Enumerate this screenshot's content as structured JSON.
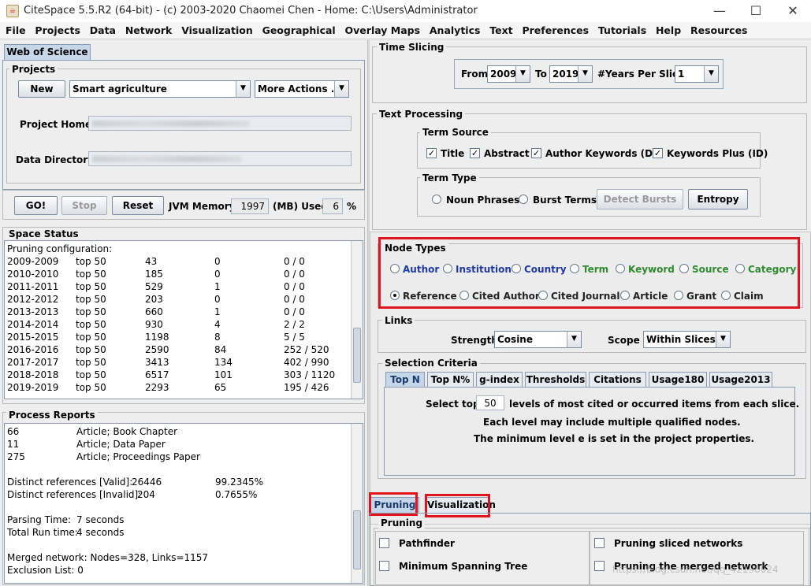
{
  "window": {
    "title": "CiteSpace 5.5.R2 (64-bit) - (c) 2003-2020 Chaomei Chen - Home: C:\\Users\\Administrator",
    "minimize": "—",
    "maximize": "☐",
    "close": "✕"
  },
  "menu": [
    "File",
    "Projects",
    "Data",
    "Network",
    "Visualization",
    "Geographical",
    "Overlay Maps",
    "Analytics",
    "Text",
    "Preferences",
    "Tutorials",
    "Help",
    "Resources"
  ],
  "left": {
    "source_tab": "Web of Science",
    "projects": {
      "legend": "Projects",
      "new_button": "New",
      "project_name": "Smart agriculture",
      "more_actions": "More Actions ...",
      "project_home_label": "Project Home:",
      "data_directory_label": "Data Directory:"
    },
    "controls": {
      "go": "GO!",
      "stop": "Stop",
      "reset": "Reset",
      "jvm_label": "JVM Memory",
      "jvm_value": "1997",
      "mb_used_label": "(MB) Used",
      "used_value": "6",
      "percent": "%"
    },
    "space_status": {
      "legend": "Space Status",
      "header": "Pruning configuration:",
      "rows": [
        [
          "2009-2009",
          "top 50",
          "43",
          "0",
          "0 / 0"
        ],
        [
          "2010-2010",
          "top 50",
          "185",
          "0",
          "0 / 0"
        ],
        [
          "2011-2011",
          "top 50",
          "529",
          "1",
          "0 / 0"
        ],
        [
          "2012-2012",
          "top 50",
          "203",
          "0",
          "0 / 0"
        ],
        [
          "2013-2013",
          "top 50",
          "660",
          "1",
          "0 / 0"
        ],
        [
          "2014-2014",
          "top 50",
          "930",
          "4",
          "2 / 2"
        ],
        [
          "2015-2015",
          "top 50",
          "1198",
          "8",
          "5 / 5"
        ],
        [
          "2016-2016",
          "top 50",
          "2590",
          "84",
          "252 / 520"
        ],
        [
          "2017-2017",
          "top 50",
          "3413",
          "134",
          "402 / 990"
        ],
        [
          "2018-2018",
          "top 50",
          "6517",
          "101",
          "303 / 1120"
        ],
        [
          "2019-2019",
          "top 50",
          "2293",
          "65",
          "195 / 426"
        ]
      ]
    },
    "process_reports": {
      "legend": "Process Reports",
      "doc_rows": [
        [
          "66",
          "Article; Book Chapter"
        ],
        [
          "11",
          "Article; Data Paper"
        ],
        [
          "275",
          "Article; Proceedings Paper"
        ]
      ],
      "valid_label": "Distinct references [Valid]:",
      "valid_count": "26446",
      "valid_pct": "99.2345%",
      "invalid_label": "Distinct references [Invalid]:",
      "invalid_count": "204",
      "invalid_pct": "0.7655%",
      "parsing_label": "Parsing Time:",
      "parsing_value": "7 seconds",
      "total_label": "Total Run time:",
      "total_value": "4 seconds",
      "merged": "Merged network: Nodes=328, Links=1157",
      "exclusion": "Exclusion List: 0"
    }
  },
  "right": {
    "time_slicing": {
      "legend": "Time Slicing",
      "from_label": "From",
      "from_value": "2009",
      "to_label": "To",
      "to_value": "2019",
      "years_label": "#Years Per Slice",
      "years_value": "1"
    },
    "text_processing": {
      "legend": "Text Processing",
      "term_source_legend": "Term Source",
      "sources": [
        "Title",
        "Abstract",
        "Author Keywords (DE)",
        "Keywords Plus (ID)"
      ],
      "term_type_legend": "Term Type",
      "noun_phrases": "Noun Phrases",
      "burst_terms": "Burst Terms",
      "detect_bursts": "Detect Bursts",
      "entropy": "Entropy"
    },
    "node_types": {
      "legend": "Node Types",
      "row1": [
        {
          "label": "Author",
          "color": "#1f3aa8"
        },
        {
          "label": "Institution",
          "color": "#1f3aa8"
        },
        {
          "label": "Country",
          "color": "#1f3aa8"
        },
        {
          "label": "Term",
          "color": "#2e8b2e"
        },
        {
          "label": "Keyword",
          "color": "#2e8b2e"
        },
        {
          "label": "Source",
          "color": "#2e8b2e"
        },
        {
          "label": "Category",
          "color": "#2e8b2e"
        }
      ],
      "row2": [
        "Reference",
        "Cited Author",
        "Cited Journal",
        "Article",
        "Grant",
        "Claim"
      ]
    },
    "links": {
      "legend": "Links",
      "strength_label": "Strength",
      "strength_value": "Cosine",
      "scope_label": "Scope",
      "scope_value": "Within Slices"
    },
    "selection": {
      "legend": "Selection Criteria",
      "tabs": [
        "Top N",
        "Top N%",
        "g-index",
        "Thresholds",
        "Citations",
        "Usage180",
        "Usage2013"
      ],
      "select_top_label": "Select top",
      "select_top_value": "50",
      "select_top_suffix": "levels of most cited or occurred items from each slice.",
      "line2": "Each level may include multiple qualified nodes.",
      "line3": "The minimum level e is set in the project properties."
    },
    "bottom_tabs": [
      "Pruning",
      "Visualization"
    ],
    "pruning": {
      "legend": "Pruning",
      "pathfinder": "Pathfinder",
      "mst": "Minimum Spanning Tree",
      "sliced": "Pruning sliced networks",
      "merged": "Pruning the merged network"
    },
    "watermark": "https://blog.csdn.net/qq_42198024"
  },
  "colors": {
    "highlight": "#e0141e",
    "blue_label": "#1f3aa8",
    "green_label": "#2e8b2e"
  }
}
